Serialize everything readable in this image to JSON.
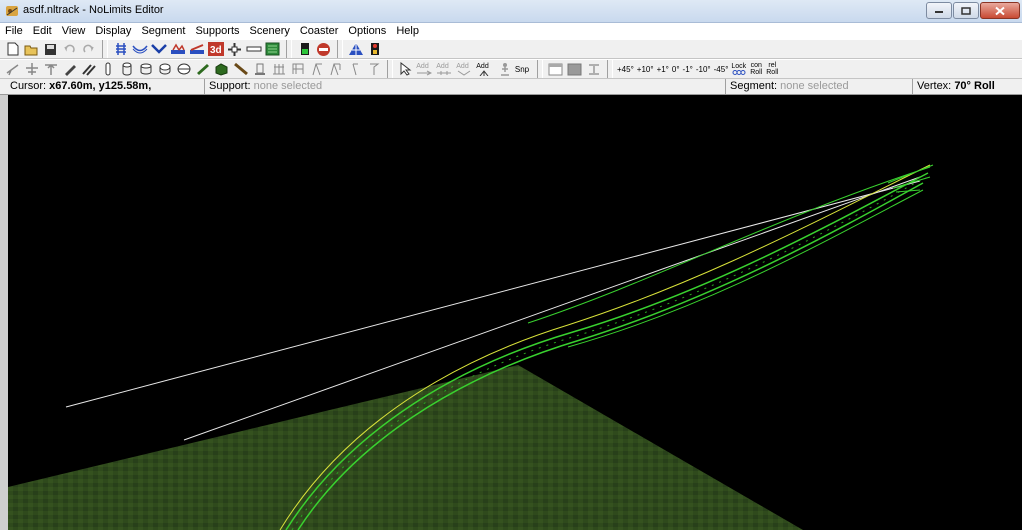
{
  "window": {
    "title": "asdf.nltrack - NoLimits Editor"
  },
  "menu": {
    "items": [
      "File",
      "Edit",
      "View",
      "Display",
      "Segment",
      "Supports",
      "Scenery",
      "Coaster",
      "Options",
      "Help"
    ]
  },
  "toolbar2": {
    "add_labels": [
      "Add",
      "Add",
      "Add",
      "Add"
    ],
    "snp": "Snp",
    "roll_angles": [
      "+45°",
      "+10°",
      "+1°",
      "0°",
      "-1°",
      "-10°",
      "-45°"
    ],
    "lock_label": "Lock",
    "con_roll": [
      "con",
      "Roll"
    ],
    "rel_roll": [
      "rel",
      "Roll"
    ]
  },
  "status": {
    "cursor_key": "Cursor:",
    "cursor_val": "x67.60m, y125.58m,",
    "support_key": "Support:",
    "support_val": "none selected",
    "segment_key": "Segment:",
    "segment_val": "none selected",
    "vertex_key": "Vertex:",
    "vertex_val": "70° Roll"
  },
  "colors": {
    "track_green": "#39d12f",
    "track_yellow": "#d8e23a",
    "guide_white": "#e8e8e8",
    "ground": "#2f4a1c"
  }
}
